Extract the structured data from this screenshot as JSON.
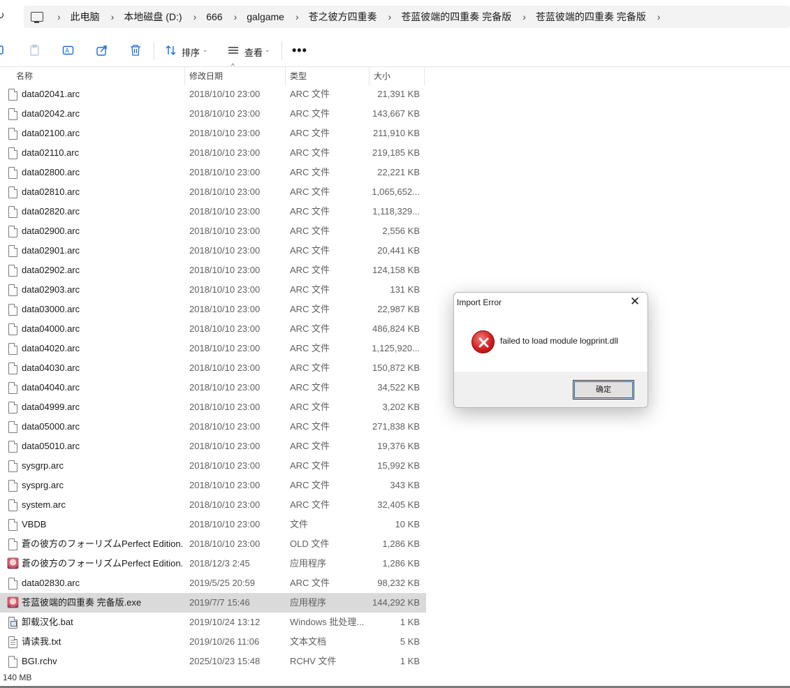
{
  "address": {
    "crumbs": [
      "此电脑",
      "本地磁盘 (D:)",
      "666",
      "galgame",
      "苍之彼方四重奏",
      "苍蓝彼端的四重奏 完备版",
      "苍蓝彼端的四重奏 完备版"
    ]
  },
  "toolbar": {
    "sort_label": "排序",
    "view_label": "查看",
    "more_label": "•••"
  },
  "columns": {
    "name": "名称",
    "date": "修改日期",
    "type": "类型",
    "size": "大小",
    "sort_indicator": "^"
  },
  "files": [
    {
      "name": "data02041.arc",
      "date": "2018/10/10 23:00",
      "type": "ARC 文件",
      "size": "21,391 KB",
      "icon": "file"
    },
    {
      "name": "data02042.arc",
      "date": "2018/10/10 23:00",
      "type": "ARC 文件",
      "size": "143,667 KB",
      "icon": "file"
    },
    {
      "name": "data02100.arc",
      "date": "2018/10/10 23:00",
      "type": "ARC 文件",
      "size": "211,910 KB",
      "icon": "file"
    },
    {
      "name": "data02110.arc",
      "date": "2018/10/10 23:00",
      "type": "ARC 文件",
      "size": "219,185 KB",
      "icon": "file"
    },
    {
      "name": "data02800.arc",
      "date": "2018/10/10 23:00",
      "type": "ARC 文件",
      "size": "22,221 KB",
      "icon": "file"
    },
    {
      "name": "data02810.arc",
      "date": "2018/10/10 23:00",
      "type": "ARC 文件",
      "size": "1,065,652...",
      "icon": "file"
    },
    {
      "name": "data02820.arc",
      "date": "2018/10/10 23:00",
      "type": "ARC 文件",
      "size": "1,118,329...",
      "icon": "file"
    },
    {
      "name": "data02900.arc",
      "date": "2018/10/10 23:00",
      "type": "ARC 文件",
      "size": "2,556 KB",
      "icon": "file"
    },
    {
      "name": "data02901.arc",
      "date": "2018/10/10 23:00",
      "type": "ARC 文件",
      "size": "20,441 KB",
      "icon": "file"
    },
    {
      "name": "data02902.arc",
      "date": "2018/10/10 23:00",
      "type": "ARC 文件",
      "size": "124,158 KB",
      "icon": "file"
    },
    {
      "name": "data02903.arc",
      "date": "2018/10/10 23:00",
      "type": "ARC 文件",
      "size": "131 KB",
      "icon": "file"
    },
    {
      "name": "data03000.arc",
      "date": "2018/10/10 23:00",
      "type": "ARC 文件",
      "size": "22,987 KB",
      "icon": "file"
    },
    {
      "name": "data04000.arc",
      "date": "2018/10/10 23:00",
      "type": "ARC 文件",
      "size": "486,824 KB",
      "icon": "file"
    },
    {
      "name": "data04020.arc",
      "date": "2018/10/10 23:00",
      "type": "ARC 文件",
      "size": "1,125,920...",
      "icon": "file"
    },
    {
      "name": "data04030.arc",
      "date": "2018/10/10 23:00",
      "type": "ARC 文件",
      "size": "150,872 KB",
      "icon": "file"
    },
    {
      "name": "data04040.arc",
      "date": "2018/10/10 23:00",
      "type": "ARC 文件",
      "size": "34,522 KB",
      "icon": "file"
    },
    {
      "name": "data04999.arc",
      "date": "2018/10/10 23:00",
      "type": "ARC 文件",
      "size": "3,202 KB",
      "icon": "file"
    },
    {
      "name": "data05000.arc",
      "date": "2018/10/10 23:00",
      "type": "ARC 文件",
      "size": "271,838 KB",
      "icon": "file"
    },
    {
      "name": "data05010.arc",
      "date": "2018/10/10 23:00",
      "type": "ARC 文件",
      "size": "19,376 KB",
      "icon": "file"
    },
    {
      "name": "sysgrp.arc",
      "date": "2018/10/10 23:00",
      "type": "ARC 文件",
      "size": "15,992 KB",
      "icon": "file"
    },
    {
      "name": "sysprg.arc",
      "date": "2018/10/10 23:00",
      "type": "ARC 文件",
      "size": "343 KB",
      "icon": "file"
    },
    {
      "name": "system.arc",
      "date": "2018/10/10 23:00",
      "type": "ARC 文件",
      "size": "32,405 KB",
      "icon": "file"
    },
    {
      "name": "VBDB",
      "date": "2018/10/10 23:00",
      "type": "文件",
      "size": "10 KB",
      "icon": "file"
    },
    {
      "name": "蒼の彼方のフォーリズムPerfect Edition...",
      "date": "2018/10/10 23:00",
      "type": "OLD 文件",
      "size": "1,286 KB",
      "icon": "file"
    },
    {
      "name": "蒼の彼方のフォーリズムPerfect Edition...",
      "date": "2018/12/3 2:45",
      "type": "应用程序",
      "size": "1,286 KB",
      "icon": "app"
    },
    {
      "name": "data02830.arc",
      "date": "2019/5/25 20:59",
      "type": "ARC 文件",
      "size": "98,232 KB",
      "icon": "file"
    },
    {
      "name": "苍蓝彼端的四重奏 完备版.exe",
      "date": "2019/7/7 15:46",
      "type": "应用程序",
      "size": "144,292 KB",
      "icon": "app",
      "selected": true
    },
    {
      "name": "卸载汉化.bat",
      "date": "2019/10/24 13:12",
      "type": "Windows 批处理...",
      "size": "1 KB",
      "icon": "bat"
    },
    {
      "name": "请读我.txt",
      "date": "2019/10/26 11:06",
      "type": "文本文档",
      "size": "5 KB",
      "icon": "txt"
    },
    {
      "name": "BGI.rchv",
      "date": "2025/10/23 15:48",
      "type": "RCHV 文件",
      "size": "1 KB",
      "icon": "file"
    }
  ],
  "status": {
    "selection_size": "140 MB"
  },
  "dialog": {
    "title": "Import Error",
    "close_glyph": "✕",
    "message": "failed to load module logprint.dll",
    "ok_label": "确定"
  },
  "colors": {
    "accent": "#1a6fd1",
    "selected_row": "#dadada",
    "error_red": "#d21f1f"
  }
}
